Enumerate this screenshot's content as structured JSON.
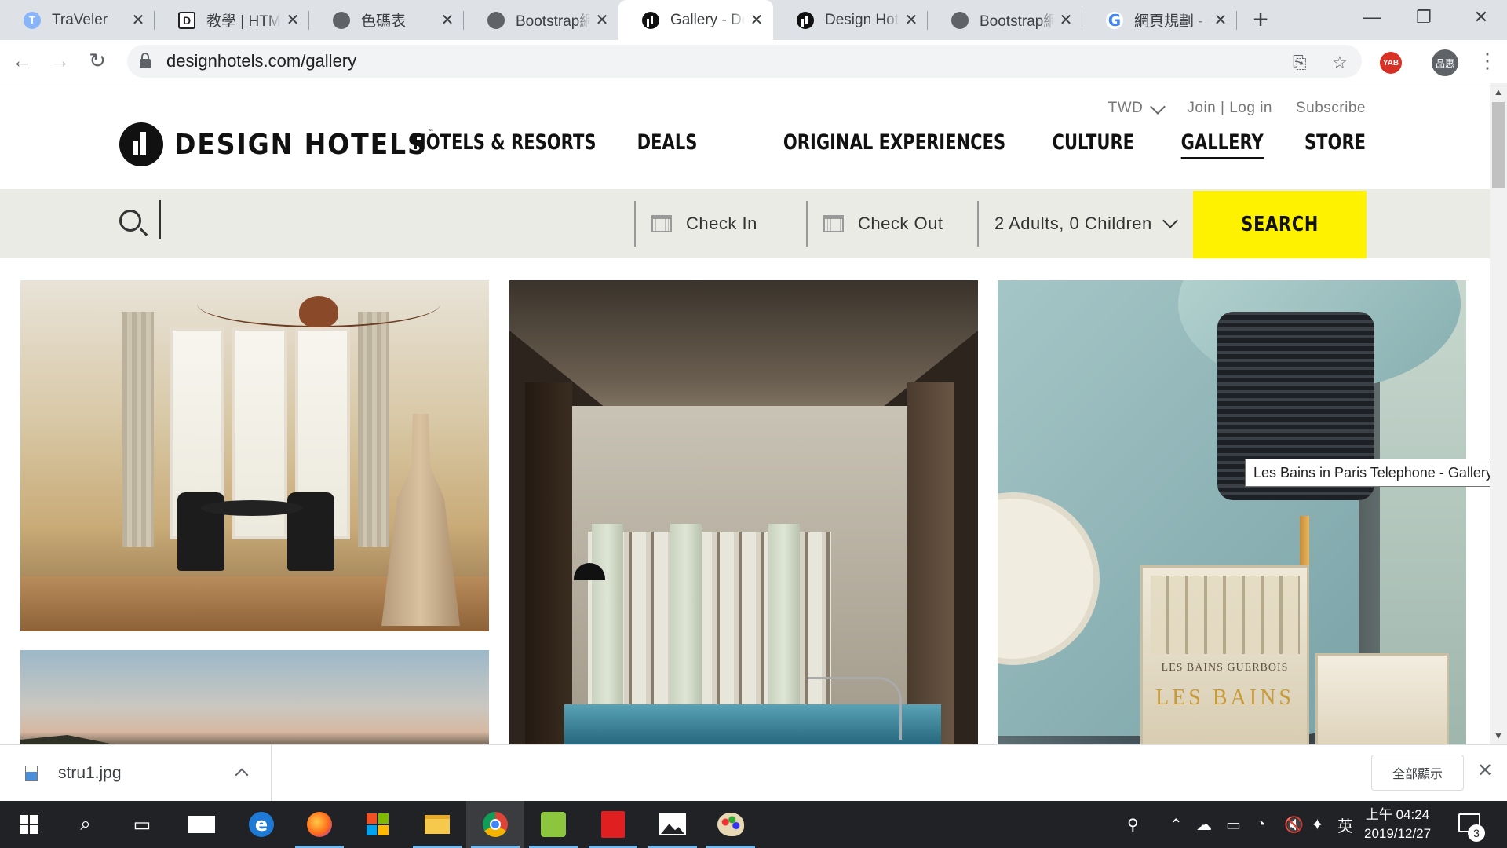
{
  "browser": {
    "tabs": [
      {
        "title": "TraVeler",
        "favicon": "traveler-icon",
        "active": false
      },
      {
        "title": "教學 | HTML",
        "favicon": "document-d-icon",
        "active": false
      },
      {
        "title": "色碼表",
        "favicon": "globe-icon",
        "active": false
      },
      {
        "title": "Bootstrap網",
        "favicon": "globe-icon",
        "active": false
      },
      {
        "title": "Gallery - De",
        "favicon": "design-hotels-icon",
        "active": true
      },
      {
        "title": "Design Hote",
        "favicon": "design-hotels-icon",
        "active": false
      },
      {
        "title": "Bootstrap網",
        "favicon": "globe-icon",
        "active": false
      },
      {
        "title": "網頁規劃 - G",
        "favicon": "google-icon",
        "active": false
      }
    ],
    "url": "designhotels.com/gallery",
    "extension_label": "YAB",
    "profile_label": "品惠"
  },
  "site": {
    "currency": "TWD",
    "join_login": "Join | Log in",
    "subscribe": "Subscribe",
    "logo_text": "DESIGN HOTELS",
    "nav": [
      {
        "label": "HOTELS & RESORTS",
        "current": false
      },
      {
        "label": "DEALS",
        "current": false
      },
      {
        "label": "ORIGINAL EXPERIENCES",
        "current": false
      },
      {
        "label": "CULTURE",
        "current": false
      },
      {
        "label": "GALLERY",
        "current": true
      },
      {
        "label": "STORE",
        "current": false
      }
    ],
    "search": {
      "placeholder": "",
      "check_in": "Check In",
      "check_out": "Check Out",
      "guests": "2 Adults, 0 Children",
      "button": "SEARCH",
      "button_color": "#fef200"
    },
    "gallery": {
      "book_label": "LES BAINS GUERBOIS",
      "book_brand": "LES BAINS",
      "tooltip": "Les Bains in Paris Telephone - Gallery"
    }
  },
  "downloads": {
    "file": "stru1.jpg",
    "show_all": "全部顯示"
  },
  "taskbar": {
    "apps": [
      "start-icon",
      "search-icon",
      "task-view-icon",
      "mail-icon",
      "edge-icon",
      "firefox-icon",
      "store-icon",
      "file-explorer-icon",
      "chrome-icon",
      "kid-pix-icon",
      "acrobat-icon",
      "photos-icon",
      "paint-icon"
    ],
    "ime": "英",
    "time": "上午 04:24",
    "date": "2019/12/27",
    "notifications": "3"
  }
}
